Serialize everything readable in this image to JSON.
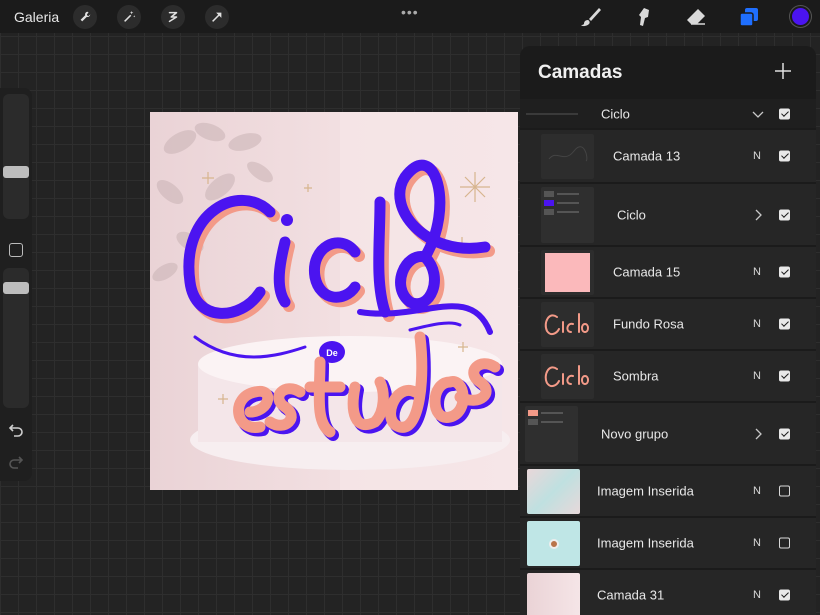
{
  "topbar": {
    "gallery_label": "Galeria",
    "more_glyph": "•••",
    "left_tools": [
      "wrench-icon",
      "magic-wand-icon",
      "selection-icon",
      "transform-arrow-icon"
    ],
    "right_tools": [
      "brush-icon",
      "smudge-icon",
      "eraser-icon",
      "layers-icon"
    ],
    "current_color": "#4b14f0"
  },
  "canvas": {
    "artwork_colors": {
      "purple": "#4b14f0",
      "peach": "#f39a88",
      "background": "#f2dfe1"
    }
  },
  "layers_panel": {
    "title": "Camadas",
    "layers": [
      {
        "name": "Ciclo",
        "kind": "group-open",
        "blend": "",
        "visible": true
      },
      {
        "name": "Camada 13",
        "kind": "layer",
        "blend": "N",
        "visible": true
      },
      {
        "name": "Ciclo",
        "kind": "group",
        "blend": "",
        "visible": true
      },
      {
        "name": "Camada 15",
        "kind": "layer",
        "blend": "N",
        "visible": true
      },
      {
        "name": "Fundo Rosa",
        "kind": "layer",
        "blend": "N",
        "visible": true
      },
      {
        "name": "Sombra",
        "kind": "layer",
        "blend": "N",
        "visible": true
      },
      {
        "name": "Novo grupo",
        "kind": "group",
        "blend": "",
        "visible": true
      },
      {
        "name": "Imagem Inserida",
        "kind": "layer",
        "blend": "N",
        "visible": false
      },
      {
        "name": "Imagem Inserida",
        "kind": "layer",
        "blend": "N",
        "visible": false
      },
      {
        "name": "Camada 31",
        "kind": "layer",
        "blend": "N",
        "visible": true
      }
    ]
  }
}
